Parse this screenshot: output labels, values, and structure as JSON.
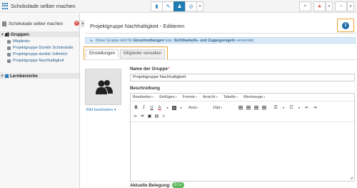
{
  "app": {
    "title": "Schokolade selber machen"
  },
  "topbar": {
    "nav_icons": [
      "book-icon",
      "pencil-icon",
      "group-icon",
      "target-icon"
    ],
    "active_index": 2,
    "right_icons": [
      "search-icon",
      "star-icon",
      "help-icon"
    ]
  },
  "sidebar": {
    "header": "Schokolade selber machen",
    "groups_label": "Gruppen",
    "items": [
      "Mitglieder",
      "Projektgruppe Dunkle Schokolade",
      "Projektgruppe dunkle Vollmilch",
      "Projektgruppe Nachhaltigkeit"
    ],
    "learning_label": "Lernbereiche"
  },
  "main": {
    "title": "Projektgruppe Nachhaltigkeit - Editieren",
    "notice": {
      "prefix": "Diese Gruppe wird für",
      "bold1": "Einschreibungen",
      "mid": "bzw.",
      "bold2": "Sichtbarkeits- und Zugangsregeln",
      "suffix": "verwendet"
    },
    "tabs": [
      "Einstellungen",
      "Mitglieder verwalten"
    ],
    "edit_image_label": "Bild bearbeiten",
    "name_label": "Name der Gruppe",
    "required_marker": "*",
    "name_value": "Projektgruppe Nachhaltigkeit",
    "description_label": "Beschreibung",
    "editor": {
      "menus": [
        "Bearbeiten",
        "Einfügen",
        "Format",
        "Ansicht",
        "Tabelle",
        "Werkzeuge"
      ],
      "font": "Arial",
      "size": "10pt"
    },
    "occupancy_label": "Aktuelle Belegung:",
    "occupancy_value": "0 / ∞"
  },
  "colors": {
    "accent": "#1f7db5",
    "highlight": "#f0a030",
    "badge": "#5cb85c",
    "close": "#d9534f"
  }
}
